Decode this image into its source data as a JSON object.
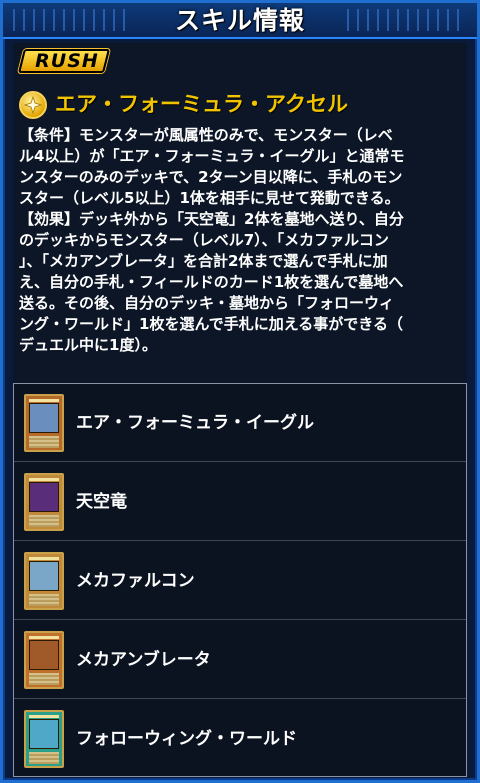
{
  "header": {
    "title": "スキル情報"
  },
  "badge": {
    "label": "RUSH"
  },
  "skill": {
    "name": "エア・フォーミュラ・アクセル",
    "description_lines": [
      "【条件】モンスターが風属性のみで、モンスター（レベ",
      "ル4以上）が「エア・フォーミュラ・イーグル」と通常モ",
      "ンスターのみのデッキで、2ターン目以降に、手札のモン",
      "スター（レベル5以上）1体を相手に見せて発動できる。",
      "【効果】デッキ外から「天空竜」2体を墓地へ送り、自分",
      "のデッキからモンスター（レベル7）、「メカファルコン",
      "」、「メカアンブレータ」を合計2体まで選んで手札に加",
      "え、自分の手札・フィールドのカード1枚を選んで墓地へ",
      "送る。その後、自分のデッキ・墓地から「フォローウィ",
      "ング・ワールド」1枚を選んで手札に加える事ができる（",
      "デュエル中に1度）。"
    ]
  },
  "cards": [
    {
      "name": "エア・フォーミュラ・イーグル",
      "frame": "#b66a2a",
      "art": "#6a8fbf"
    },
    {
      "name": "天空竜",
      "frame": "#c08a3a",
      "art": "#5a2d7a"
    },
    {
      "name": "メカファルコン",
      "frame": "#c08a3a",
      "art": "#7aa6c8"
    },
    {
      "name": "メカアンブレータ",
      "frame": "#c0702a",
      "art": "#a05a2a"
    },
    {
      "name": "フォローウィング・ワールド",
      "frame": "#2aa08a",
      "art": "#4fa8c8"
    }
  ]
}
